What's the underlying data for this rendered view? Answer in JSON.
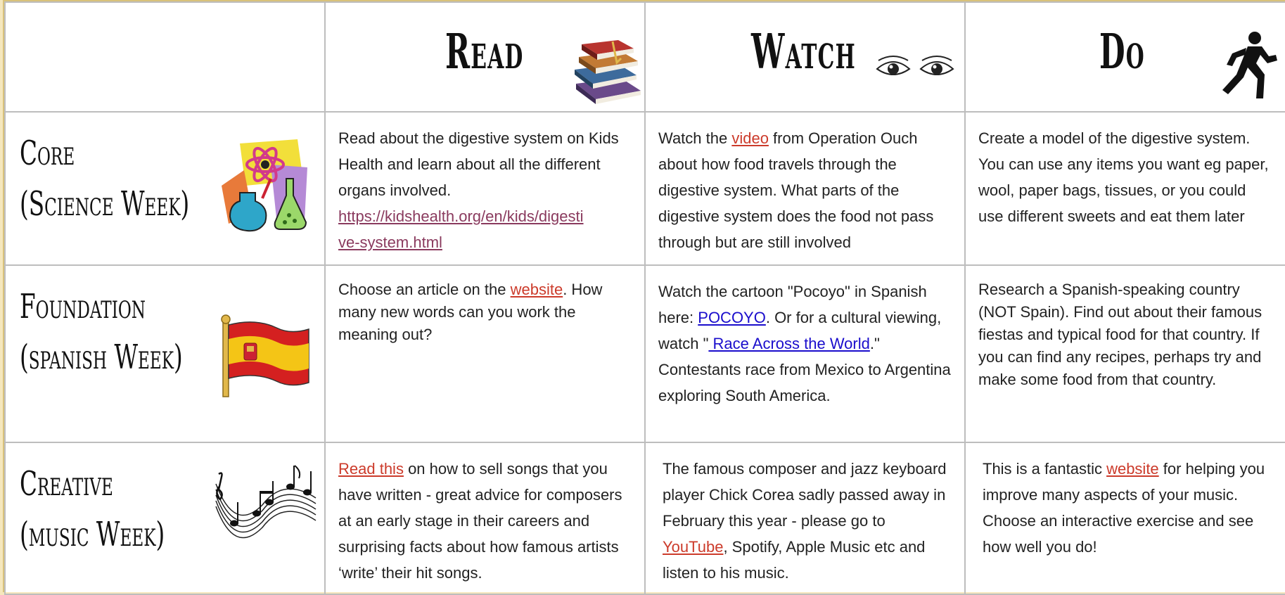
{
  "headers": {
    "read": "Read",
    "watch": "Watch",
    "do": "Do"
  },
  "icons": {
    "read": "books-icon",
    "watch": "eyes-icon",
    "do": "running-person-icon",
    "core": "science-flask-atom-icon",
    "foundation": "spain-flag-icon",
    "creative": "music-notes-icon"
  },
  "rows": {
    "core": {
      "label_line1": "Core",
      "label_line2": "(Science Week)",
      "read_text": "Read about the digestive system on Kids Health and learn about all the different organs involved.",
      "read_link": "https://kidshealth.org/en/kids/digestive-system.html",
      "read_link_line1": "https://kidshealth.org/en/kids/digesti",
      "read_link_line2": "ve-system.html",
      "watch_pre": "Watch the ",
      "watch_link": "video",
      "watch_post": " from Operation Ouch about how food travels through the digestive system. What parts of the digestive system does the food not pass through but are still involved",
      "do_text": "Create a model of the digestive system. You can use any items you want eg paper, wool, paper bags, tissues, or you could use different sweets and eat them later"
    },
    "foundation": {
      "label_line1": "Foundation",
      "label_line2": "(spanish Week)",
      "read_pre": "Choose an article on the ",
      "read_link": "website",
      "read_post": ". How many new words can you work the meaning out?",
      "watch_pre": "Watch the cartoon \"Pocoyo\" in Spanish here: ",
      "watch_link1": "POCOYO",
      "watch_mid": ". Or for a cultural viewing, watch \"",
      "watch_link2": " Race Across the World",
      "watch_post": ".\" Contestants race from Mexico to Argentina exploring South America.",
      "do_text": "Research a Spanish-speaking country (NOT Spain). Find out about their famous fiestas and typical food for that country. If you can find any recipes, perhaps try and make some food from that country."
    },
    "creative": {
      "label_line1": "Creative",
      "label_line2": "(music  Week)",
      "read_link": "Read this",
      "read_post": " on how to sell songs that you have written - great advice for composers at an early stage in their careers and surprising facts about how famous artists ‘write’ their hit songs.",
      "watch_pre": "The famous composer and jazz keyboard player Chick Corea sadly passed away in February this year - please go to ",
      "watch_link": "YouTube",
      "watch_post": ", Spotify, Apple Music etc and listen to his music.",
      "do_pre": "This is a fantastic ",
      "do_link": "website",
      "do_post": " for helping you improve many aspects of your music. Choose an interactive exercise and see how well you do!"
    }
  }
}
